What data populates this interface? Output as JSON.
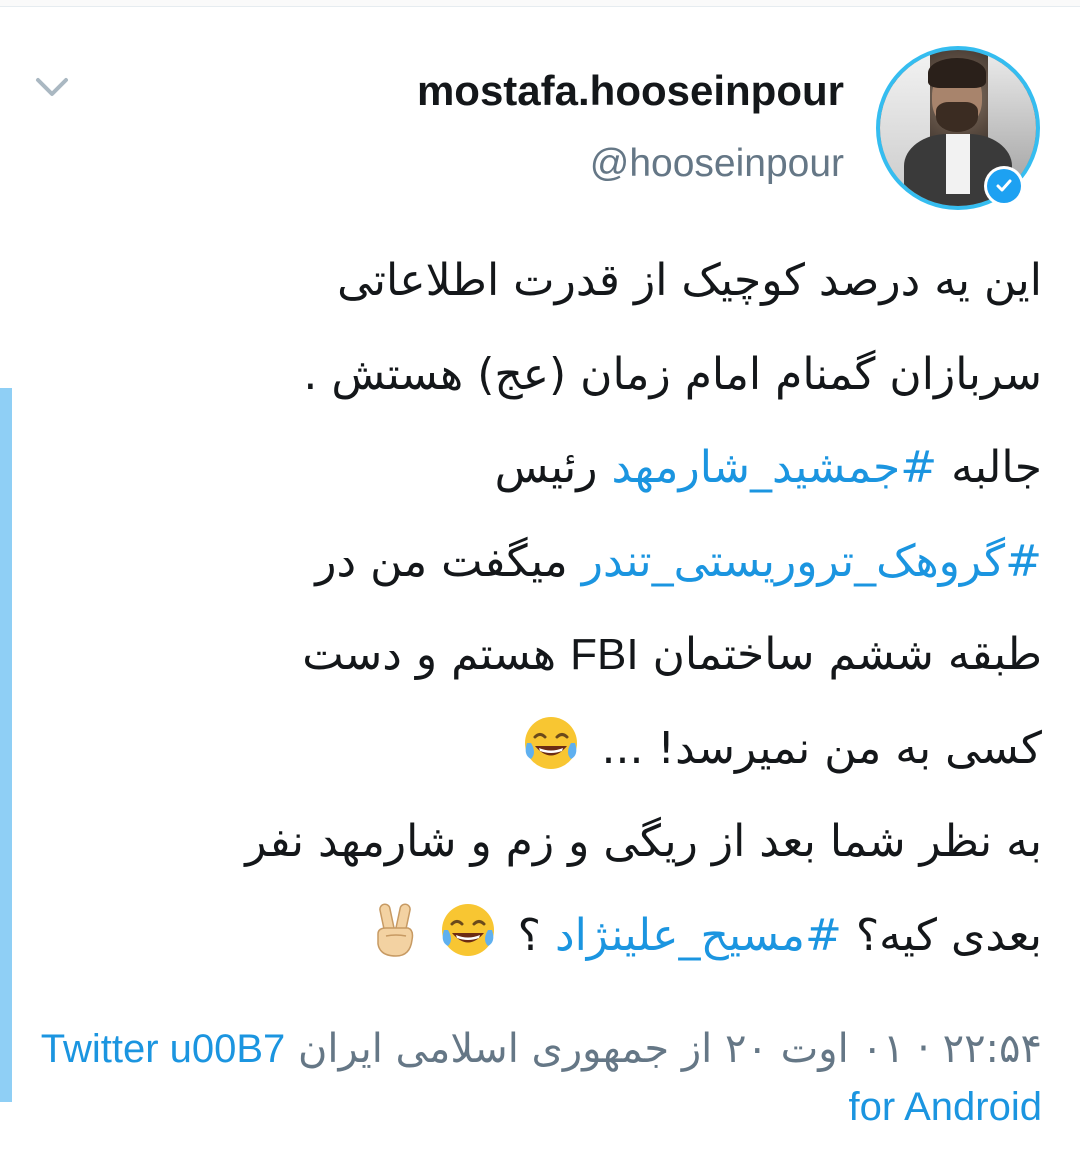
{
  "tweet": {
    "display_name": "mostafa.hooseinpour",
    "handle": "@hooseinpour",
    "icons": {
      "menu": "chevron-down-icon",
      "verified": "verified-badge-icon",
      "laugh": "face-with-tears-of-joy-icon",
      "victory": "victory-hand-icon"
    },
    "lines": {
      "l1": "این یه درصد کوچیک از قدرت اطلاعاتی",
      "l2": "سربازان گمنام امام زمان (عج) هستش .",
      "l3_a": "جالبه",
      "l3_tag": "#جمشید_شارمهد",
      "l3_b": "رئیس",
      "l4_tag": "#گروهک_تروریستی_تندر",
      "l4_b": "میگفت من در",
      "l5_a": "طبقه ششم ساختمان",
      "l5_ltr": "FBI",
      "l5_b": "هستم و دست",
      "l6": "کسی به من نمیرسد! ...",
      "l7": "به نظر شما بعد از ریگی و زم و شارمهد نفر",
      "l8_a": "بعدی کیه؟",
      "l8_tag": "#مسیح_علینژاد",
      "l8_b": "؟"
    },
    "footer": {
      "timestamp": "۲۲:۵۴ · ۰۱ اوت ۲۰ از جمهوری اسلامی ایران",
      "source_line1": "Twitter u00B7",
      "source_line2": "for Android"
    },
    "colors": {
      "link": "#1b95e0",
      "verified": "#1da1f2",
      "avatar_ring": "#35bdf0",
      "thread_line": "#8fcff5",
      "muted": "#657786"
    }
  }
}
